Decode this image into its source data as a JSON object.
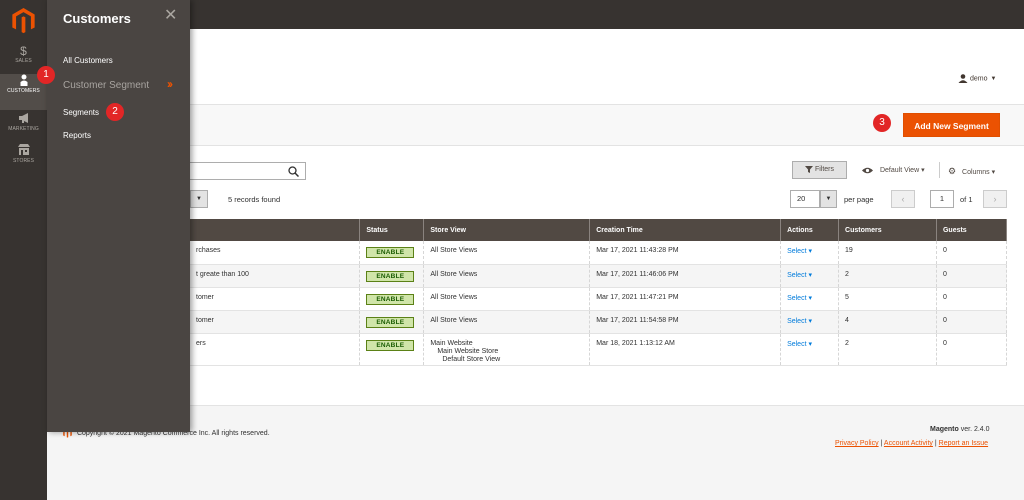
{
  "sidebar": {
    "items": [
      {
        "label": "SALES",
        "icon": "dollar-icon"
      },
      {
        "label": "CUSTOMERS",
        "icon": "person-icon"
      },
      {
        "label": "MARKETING",
        "icon": "megaphone-icon"
      },
      {
        "label": "STORES",
        "icon": "store-icon"
      }
    ]
  },
  "flyout": {
    "title": "Customers",
    "all_customers": "All Customers",
    "group_title": "Customer Segment",
    "segments": "Segments",
    "reports": "Reports"
  },
  "badges": [
    "1",
    "2",
    "3"
  ],
  "header": {
    "user": "demo"
  },
  "actions": {
    "add_new": "Add New Segment"
  },
  "toolbar": {
    "filters": "Filters",
    "default_view": "Default View",
    "columns": "Columns",
    "records_found": "5 records found",
    "per_page_value": "20",
    "per_page_label": "per page",
    "page_value": "1",
    "page_of": "of 1"
  },
  "grid": {
    "columns": [
      "",
      "Status",
      "Store View",
      "Creation Time",
      "Actions",
      "Customers",
      "Guests"
    ],
    "rows": [
      {
        "name": "rchases",
        "status": "ENABLE",
        "store": "All Store Views",
        "time": "Mar 17, 2021 11:43:28 PM",
        "action": "Select",
        "customers": "19",
        "guests": "0"
      },
      {
        "name": "t greate than 100",
        "status": "ENABLE",
        "store": "All Store Views",
        "time": "Mar 17, 2021 11:46:06 PM",
        "action": "Select",
        "customers": "2",
        "guests": "0"
      },
      {
        "name": "tomer",
        "status": "ENABLE",
        "store": "All Store Views",
        "time": "Mar 17, 2021 11:47:21 PM",
        "action": "Select",
        "customers": "5",
        "guests": "0"
      },
      {
        "name": "tomer",
        "status": "ENABLE",
        "store": "All Store Views",
        "time": "Mar 17, 2021 11:54:58 PM",
        "action": "Select",
        "customers": "4",
        "guests": "0"
      },
      {
        "name": "ers",
        "status": "ENABLE",
        "store": "Main Website",
        "store_sub1": "Main Website Store",
        "store_sub2": "Default Store View",
        "time": "Mar 18, 2021 1:13:12 AM",
        "action": "Select",
        "customers": "2",
        "guests": "0"
      }
    ]
  },
  "footer": {
    "copyright": "Copyright © 2021 Magento Commerce Inc. All rights reserved.",
    "product": "Magento",
    "version": " ver. 2.4.0",
    "links": [
      "Privacy Policy",
      "Account Activity",
      "Report an Issue"
    ]
  },
  "colors": {
    "accent": "#eb5202",
    "sidebar": "#373330",
    "badge": "#e22626",
    "grid_header": "#514943"
  }
}
